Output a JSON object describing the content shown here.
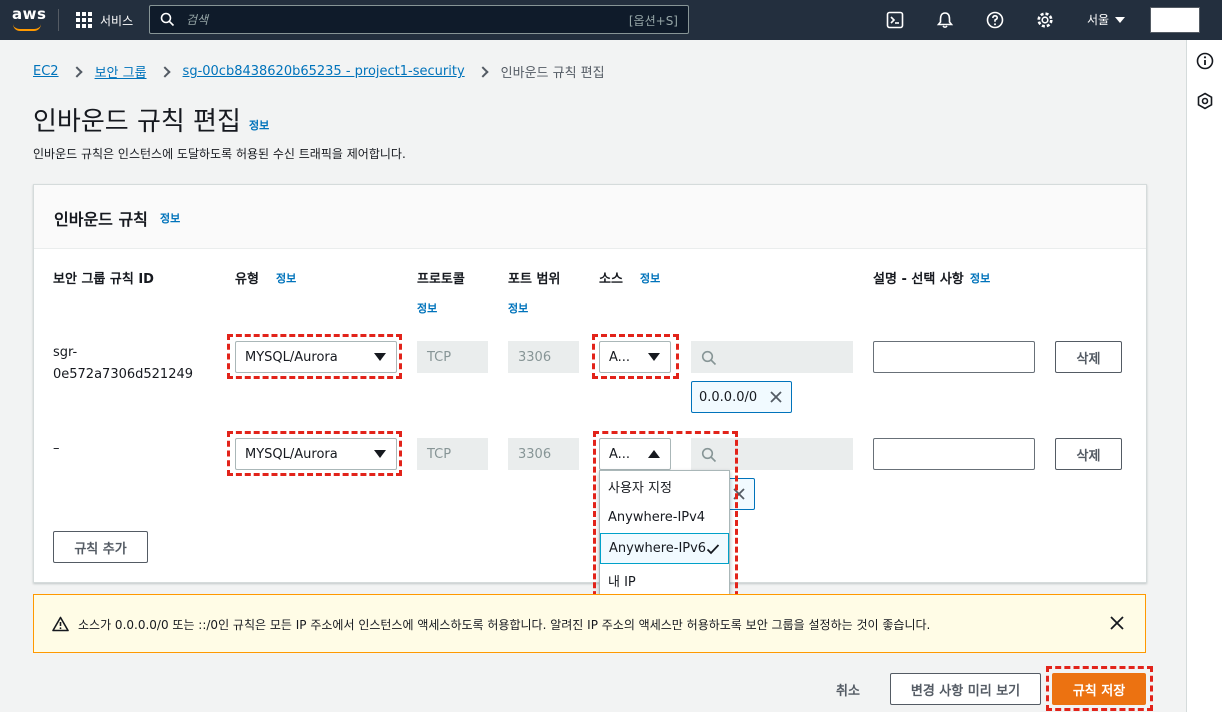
{
  "topnav": {
    "logo_text": "aws",
    "services_label": "서비스",
    "search_placeholder": "검색",
    "search_shortcut": "[옵션+S]",
    "region_label": "서울"
  },
  "breadcrumb": {
    "items": [
      "EC2",
      "보안 그룹",
      "sg-00cb8438620b65235 - project1-security"
    ],
    "current": "인바운드 규칙 편집"
  },
  "page": {
    "title": "인바운드 규칙 편집",
    "info": "정보",
    "description": "인바운드 규칙은 인스턴스에 도달하도록 허용된 수신 트래픽을 제어합니다."
  },
  "panel": {
    "title": "인바운드 규칙",
    "info": "정보",
    "columns": {
      "rule_id": "보안 그룹 규칙 ID",
      "type": "유형",
      "protocol": "프로토콜",
      "port_range": "포트 범위",
      "source": "소스",
      "description": "설명 - 선택 사항"
    },
    "info_label": "정보",
    "rows": [
      {
        "rule_id_line1": "sgr-",
        "rule_id_line2": "0e572a7306d521249",
        "type": "MYSQL/Aurora",
        "protocol": "TCP",
        "port": "3306",
        "source": "A...",
        "token": "0.0.0.0/0",
        "delete_label": "삭제"
      },
      {
        "rule_id_line1": "–",
        "type": "MYSQL/Aurora",
        "protocol": "TCP",
        "port": "3306",
        "source": "A...",
        "delete_label": "삭제"
      }
    ],
    "add_rule_label": "규칙 추가",
    "source_options": [
      "사용자 지정",
      "Anywhere-IPv4",
      "Anywhere-IPv6",
      "내 IP"
    ],
    "source_selected": "Anywhere-IPv6"
  },
  "warning": {
    "text": "소스가 0.0.0.0/0 또는 ::/0인 규칙은 모든 IP 주소에서 인스턴스에 액세스하도록 허용합니다. 알려진 IP 주소의 액세스만 허용하도록 보안 그룹을 설정하는 것이 좋습니다."
  },
  "footer": {
    "cancel_label": "취소",
    "preview_label": "변경 사항 미리 보기",
    "save_label": "규칙 저장"
  },
  "colors": {
    "nav_bg": "#232f3e",
    "link": "#0073bb",
    "primary": "#ec7211",
    "highlight_dash": "#e2231a",
    "warning_border": "#ff9900"
  }
}
